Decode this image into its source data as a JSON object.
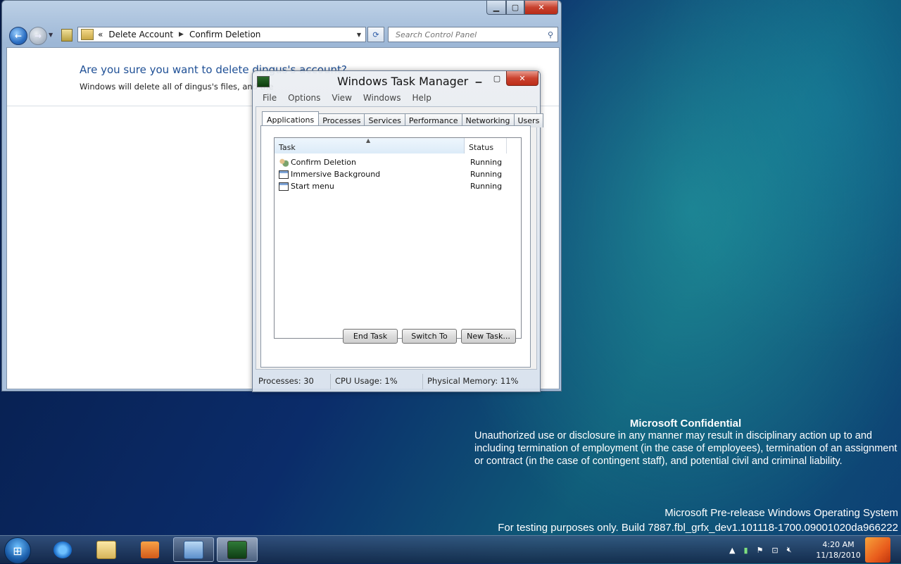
{
  "control_panel": {
    "address": {
      "prefix": "«",
      "crumbs": [
        "Delete Account",
        "Confirm Deletion"
      ]
    },
    "search_placeholder": "Search Control Panel",
    "heading": "Are you sure you want to delete dingus's account?",
    "body": "Windows will delete all of dingus's files, and the"
  },
  "task_manager": {
    "title": "Windows Task Manager",
    "menu": [
      "File",
      "Options",
      "View",
      "Windows",
      "Help"
    ],
    "tabs": [
      "Applications",
      "Processes",
      "Services",
      "Performance",
      "Networking",
      "Users"
    ],
    "active_tab": "Applications",
    "columns": {
      "task": "Task",
      "status": "Status"
    },
    "rows": [
      {
        "task": "Confirm Deletion",
        "status": "Running",
        "icon": "users-icon"
      },
      {
        "task": "Immersive Background",
        "status": "Running",
        "icon": "window-icon"
      },
      {
        "task": "Start menu",
        "status": "Running",
        "icon": "window-icon"
      }
    ],
    "buttons": {
      "end_task": "End Task",
      "switch_to": "Switch To",
      "new_task": "New Task..."
    },
    "status": {
      "processes": "Processes: 30",
      "cpu": "CPU Usage: 1%",
      "memory": "Physical Memory: 11%"
    }
  },
  "watermark": {
    "title": "Microsoft Confidential",
    "body": "Unauthorized use or disclosure in any manner may result in disciplinary action up to and including termination of employment (in the case of employees), termination of an assignment or contract (in the case of contingent staff), and potential civil and criminal liability.",
    "build_line1": "Microsoft Pre-release Windows Operating System",
    "build_line2": "For testing purposes only. Build 7887.fbl_grfx_dev1.101118-1700.09001020da966222"
  },
  "taskbar": {
    "pinned": [
      "start-orb",
      "internet-explorer-icon",
      "file-explorer-icon",
      "media-player-icon",
      "control-panel-icon",
      "task-manager-icon"
    ],
    "clock_time": "4:20 AM",
    "clock_date": "11/18/2010"
  }
}
